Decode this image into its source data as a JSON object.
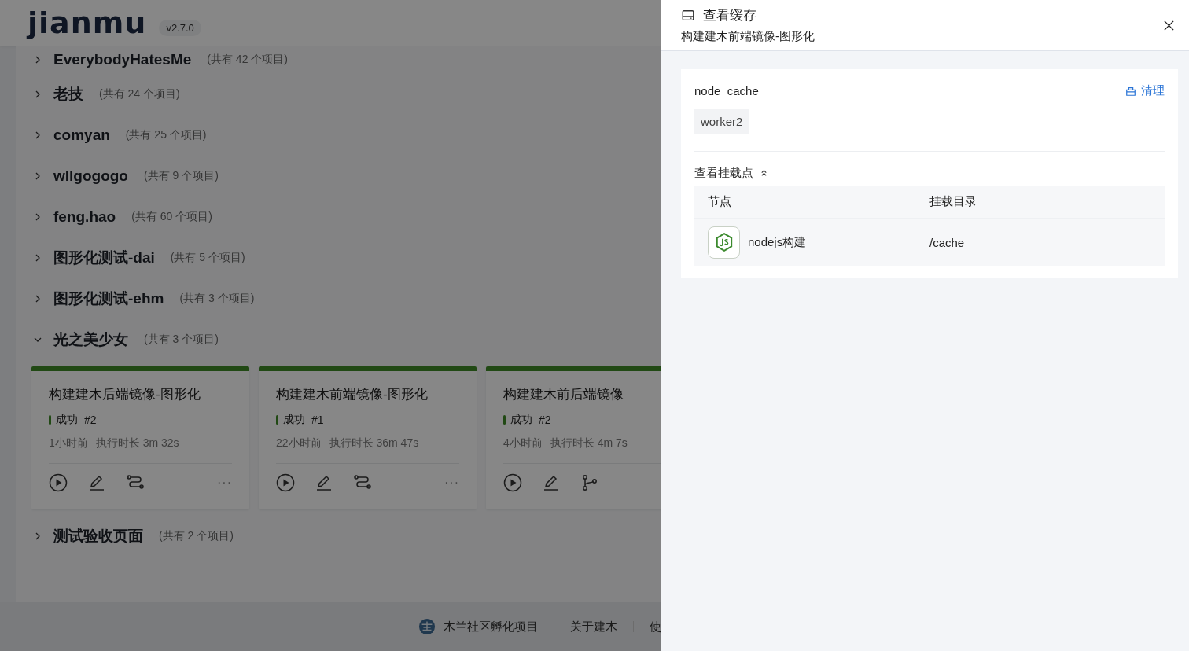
{
  "header": {
    "logo": "jianmu",
    "version": "v2.7.0"
  },
  "groups": [
    {
      "name": "EverybodyHatesMe",
      "count": "(共有 42 个项目)",
      "expanded": false
    },
    {
      "name": "老技",
      "count": "(共有 24 个项目)",
      "expanded": false
    },
    {
      "name": "comyan",
      "count": "(共有 25 个项目)",
      "expanded": false
    },
    {
      "name": "wllgogogo",
      "count": "(共有 9 个项目)",
      "expanded": false
    },
    {
      "name": "feng.hao",
      "count": "(共有 60 个项目)",
      "expanded": false
    },
    {
      "name": "图形化测试-dai",
      "count": "(共有 5 个项目)",
      "expanded": false
    },
    {
      "name": "图形化测试-ehm",
      "count": "(共有 3 个项目)",
      "expanded": false
    },
    {
      "name": "光之美少女",
      "count": "(共有 3 个项目)",
      "expanded": true,
      "projects": [
        {
          "title": "构建建木后端镜像-图形化",
          "status": "成功",
          "build": "#2",
          "time": "1小时前",
          "duration": "执行时长 3m 32s",
          "kind": "pipeline",
          "more": "···"
        },
        {
          "title": "构建建木前端镜像-图形化",
          "status": "成功",
          "build": "#1",
          "time": "22小时前",
          "duration": "执行时长 36m 47s",
          "kind": "pipeline",
          "more": "···"
        },
        {
          "title": "构建建木前后端镜像",
          "status": "成功",
          "build": "#2",
          "time": "4小时前",
          "duration": "执行时长 4m 7s",
          "kind": "graph"
        }
      ]
    },
    {
      "name": "测试验收页面",
      "count": "(共有 2 个项目)",
      "expanded": false
    }
  ],
  "footer": {
    "links": [
      "木兰社区孵化项目",
      "关于建木",
      "使"
    ]
  },
  "drawer": {
    "title": "查看缓存",
    "subtitle": "构建建木前端镜像-图形化",
    "cache": {
      "name": "node_cache",
      "clear": "清理",
      "worker": "worker2",
      "mounts_label": "查看挂载点",
      "mounts_expanded": true,
      "columns": [
        "节点",
        "挂载目录"
      ],
      "rows": [
        {
          "node": "nodejs构建",
          "dir": "/cache"
        }
      ]
    }
  }
}
